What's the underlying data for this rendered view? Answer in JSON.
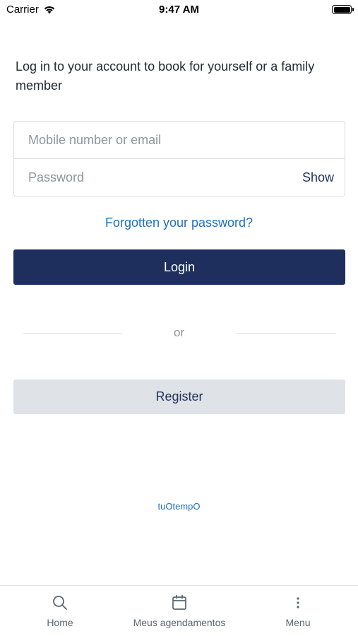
{
  "status_bar": {
    "carrier": "Carrier",
    "time": "9:47 AM",
    "battery_level": 1.0
  },
  "intro_text": "Log in to your account to book for yourself or a family member",
  "form": {
    "email_placeholder": "Mobile number or email",
    "email_value": "",
    "password_placeholder": "Password",
    "password_value": "",
    "show_label": "Show"
  },
  "forgot_password_label": "Forgotten your password?",
  "login_label": "Login",
  "or_label": "or",
  "register_label": "Register",
  "brand_link": "tuOtempO",
  "tab_bar": {
    "items": [
      {
        "label": "Home",
        "icon": "search-icon"
      },
      {
        "label": "Meus agendamentos",
        "icon": "calendar-icon"
      },
      {
        "label": "Menu",
        "icon": "more-vertical-icon"
      }
    ]
  },
  "colors": {
    "primary": "#1e2f5d",
    "link": "#1f6fbf",
    "secondary_button": "#dfe3e8",
    "placeholder": "#8e959d"
  }
}
